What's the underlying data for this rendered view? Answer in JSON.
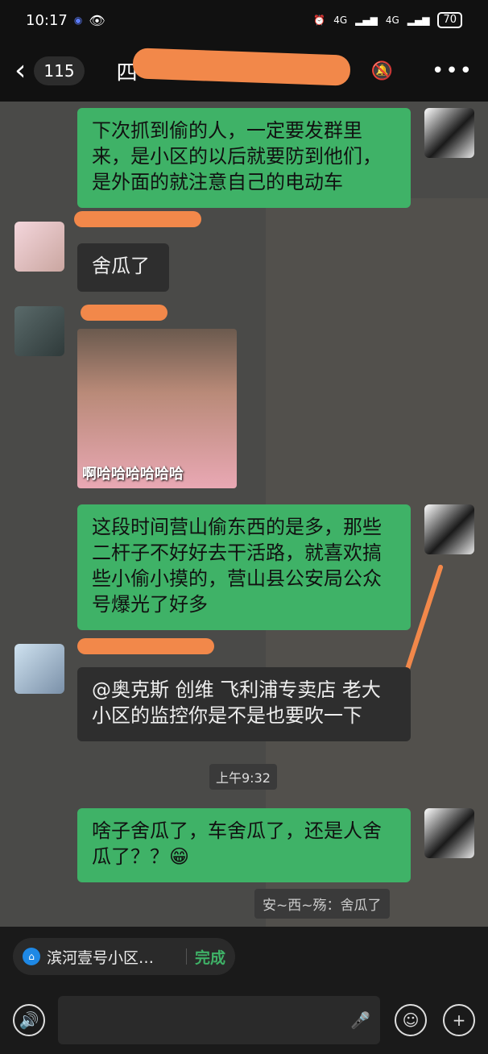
{
  "status": {
    "time": "10:17",
    "signal1": "4G",
    "signal2": "4G",
    "battery": "70"
  },
  "nav": {
    "unread_count": "115",
    "title_visible": "四"
  },
  "messages": [
    {
      "side": "right",
      "text": "下次抓到偷的人，一定要发群里来，是小区的以后就要防到他们，是外面的就注意自己的电动车"
    },
    {
      "side": "left",
      "text": "舍瓜了"
    },
    {
      "side": "left",
      "type": "image",
      "caption": "啊哈哈哈哈哈哈"
    },
    {
      "side": "right",
      "text": "这段时间营山偷东西的是多，那些二杆子不好好去干活路，就喜欢搞些小偷小摸的，营山县公安局公众号爆光了好多"
    },
    {
      "side": "left",
      "text": "@奥克斯 创维 飞利浦专卖店  老大小区的监控你是不是也要吹一下"
    },
    {
      "side": "right",
      "text": "啥子舍瓜了，车舍瓜了，还是人舍瓜了？？😁"
    }
  ],
  "time_divider": "上午9:32",
  "quote": "安~西~殇：舍瓜了",
  "announcement": {
    "text": "滨河壹号小区…",
    "done": "完成"
  },
  "icons": {
    "back": "chevron-left-icon",
    "mute": "bell-off-icon",
    "more": "more-dots-icon",
    "voice": "voice-icon",
    "mic": "mic-icon",
    "emoji": "emoji-icon",
    "plus": "plus-icon"
  },
  "colors": {
    "bubble_green": "#3fb267",
    "accent_done": "#3fb267",
    "redaction": "#f2884a"
  }
}
